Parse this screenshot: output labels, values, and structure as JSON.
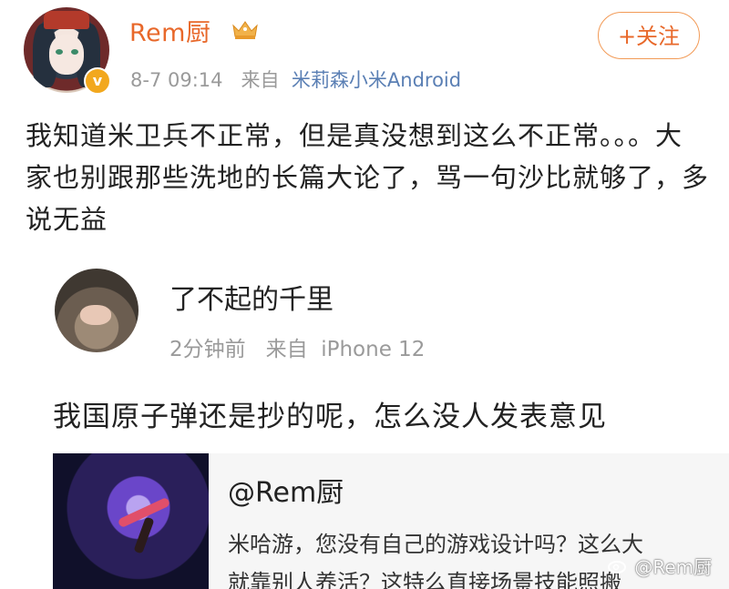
{
  "post": {
    "username": "Rem厨",
    "timestamp": "8-7 09:14",
    "source_prefix": "来自",
    "source": "米莉森小米Android",
    "follow_label": "+关注",
    "body": "我知道米卫兵不正常，但是真没想到这么不正常。。。大家也别跟那些洗地的长篇大论了，骂一句沙比就够了，多说无益"
  },
  "quoted_comment": {
    "username": "了不起的千里",
    "time": "2分钟前",
    "source_prefix": "来自",
    "source": "iPhone 12",
    "text": "我国原子弹还是抄的呢，怎么没人发表意见"
  },
  "card": {
    "title": "@Rem厨",
    "line1": "米哈游，您没有自己的游戏设计吗？这么大",
    "line2": "就靠别人养活？这特么直接场景技能照搬"
  },
  "watermark": "@Rem厨",
  "colors": {
    "username": "#e8682a",
    "source_link": "#5a7fb4",
    "meta_gray": "#9a9a9a",
    "verified_badge": "#f2a81e"
  },
  "icons": {
    "verified": "verified-badge-icon",
    "crown": "crown-icon",
    "weibo": "weibo-icon"
  }
}
